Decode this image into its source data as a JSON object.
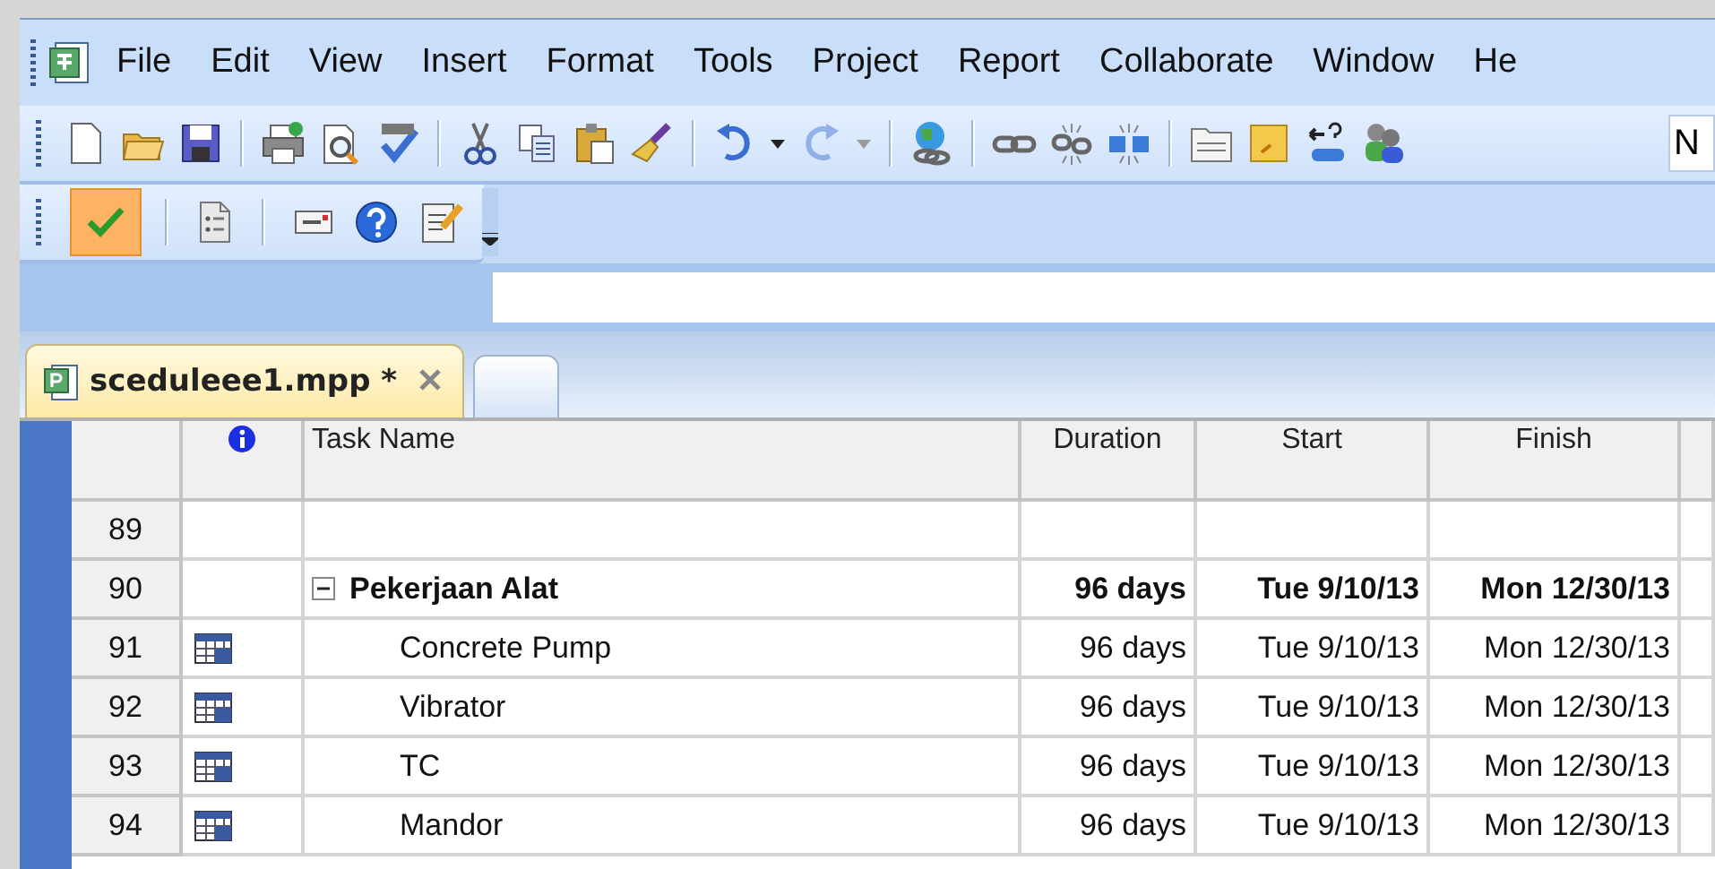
{
  "menu": [
    {
      "label": "File"
    },
    {
      "label": "Edit"
    },
    {
      "label": "View"
    },
    {
      "label": "Insert"
    },
    {
      "label": "Format"
    },
    {
      "label": "Tools"
    },
    {
      "label": "Project"
    },
    {
      "label": "Report"
    },
    {
      "label": "Collaborate"
    },
    {
      "label": "Window"
    },
    {
      "label": "He"
    }
  ],
  "standard_toolbar": {
    "buttons": [
      {
        "disabled": false
      },
      {
        "disabled": false
      },
      {
        "disabled": false
      },
      {
        "disabled": false
      },
      {
        "disabled": false
      },
      {
        "disabled": false
      },
      {
        "disabled": false
      },
      {
        "disabled": false
      },
      {
        "disabled": false
      },
      {
        "disabled": false
      },
      {
        "disabled": false
      },
      {
        "disabled": true
      },
      {
        "disabled": false
      },
      {
        "disabled": false
      },
      {
        "disabled": false
      },
      {
        "disabled": false
      },
      {
        "disabled": false
      },
      {
        "disabled": false
      },
      {
        "disabled": false
      },
      {
        "disabled": false
      }
    ],
    "font_field": {
      "value": "N"
    }
  },
  "tracking_toolbar": {
    "buttons": [
      {
        "on": true
      },
      {
        "on": false
      },
      {
        "on": false
      },
      {
        "on": false
      },
      {
        "on": false
      }
    ]
  },
  "document_tabs": [
    {
      "label": "sceduleee1.mpp *",
      "selected": true
    },
    {
      "selected": false
    }
  ],
  "table": {
    "columns": [
      {
        "kind": "number"
      },
      {
        "kind": "info"
      },
      {
        "label": "Task Name"
      },
      {
        "label": "Duration"
      },
      {
        "label": "Start"
      },
      {
        "label": "Finish"
      }
    ],
    "rows": [
      {
        "kind": "empty",
        "id": "89"
      },
      {
        "kind": "summary",
        "id": "90",
        "name": "Pekerjaan Alat",
        "duration": "96 days",
        "start": "Tue 9/10/13",
        "finish": "Mon 12/30/13",
        "expanded": true,
        "children": [
          {
            "kind": "task",
            "id": "91",
            "name": "Concrete Pump",
            "duration": "96 days",
            "start": "Tue 9/10/13",
            "finish": "Mon 12/30/13"
          },
          {
            "kind": "task",
            "id": "92",
            "name": "Vibrator",
            "duration": "96 days",
            "start": "Tue 9/10/13",
            "finish": "Mon 12/30/13"
          },
          {
            "kind": "task",
            "id": "93",
            "name": "TC",
            "duration": "96 days",
            "start": "Tue 9/10/13",
            "finish": "Mon 12/30/13"
          },
          {
            "kind": "task",
            "id": "94",
            "name": "Mandor",
            "duration": "96 days",
            "start": "Tue 9/10/13",
            "finish": "Mon 12/30/13"
          }
        ]
      }
    ]
  }
}
